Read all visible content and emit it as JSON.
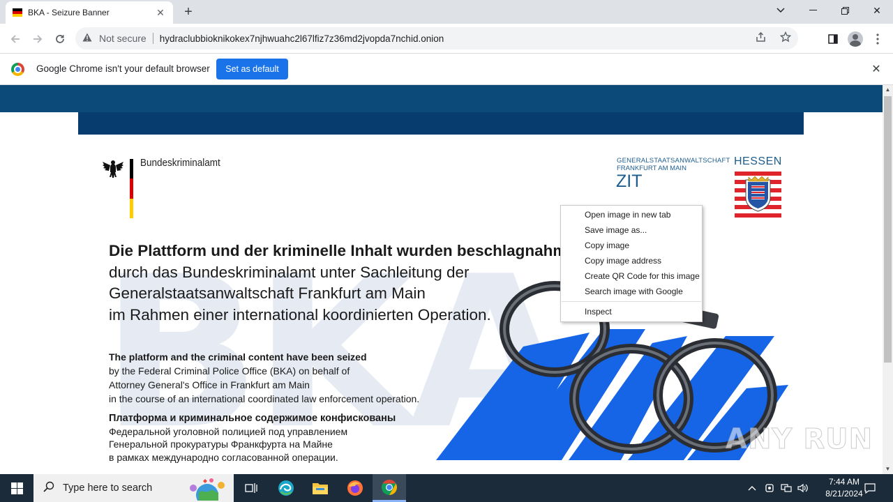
{
  "tab": {
    "title": "BKA - Seizure Banner",
    "close": "✕"
  },
  "window": {
    "minimize": "—",
    "maximize": "❐",
    "close": "✕",
    "chevron": "⌄",
    "newtab": "+"
  },
  "address": {
    "security_label": "Not secure",
    "url": "hydraclubbioknikokex7njhwuahc2l67lfiz7z36md2jvopda7nchid.onion"
  },
  "infobar": {
    "message": "Google Chrome isn't your default browser",
    "button": "Set as default",
    "close": "✕"
  },
  "page": {
    "agency": "Bundeskriminalamt",
    "gsa_line1": "GENERALSTAATSANWALTSCHAFT",
    "gsa_line2": "FRANKFURT AM MAIN",
    "zit": "ZIT",
    "hessen": "HESSEN",
    "bg_letters": "BKA",
    "de": {
      "heading": "Die Plattform und der kriminelle Inhalt wurden beschlagnahmt",
      "line1": "durch das Bundeskriminalamt unter Sachleitung der",
      "line2": "Generalstaatsanwaltschaft Frankfurt am Main",
      "line3": "im Rahmen einer international koordinierten Operation."
    },
    "en": {
      "heading": "The platform and the criminal content have been seized",
      "line1": "by the Federal Criminal Police Office (BKA) on behalf of",
      "line2": "Attorney General's Office in Frankfurt am Main",
      "line3": "in the course of an international coordinated law enforcement operation."
    },
    "ru": {
      "heading": "Платформа и криминальное содержимое конфискованы",
      "line1": "Федеральной уголовной полицией под управлением",
      "line2": "Генеральной прокуратуры Франкфурта на Майне",
      "line3": "в рамках международно согласованной операции."
    },
    "watermark": "ANY RUN"
  },
  "context_menu": {
    "items": [
      "Open image in new tab",
      "Save image as...",
      "Copy image",
      "Copy image address",
      "Create QR Code for this image",
      "Search image with Google"
    ],
    "inspect": "Inspect"
  },
  "taskbar": {
    "search_placeholder": "Type here to search",
    "time": "7:44 AM",
    "date": "8/21/2024"
  },
  "colors": {
    "banner": "#063d6e",
    "topband": "#0c4a7a",
    "accent_blue": "#1a73e8",
    "cuff_blue": "#1565e6"
  }
}
